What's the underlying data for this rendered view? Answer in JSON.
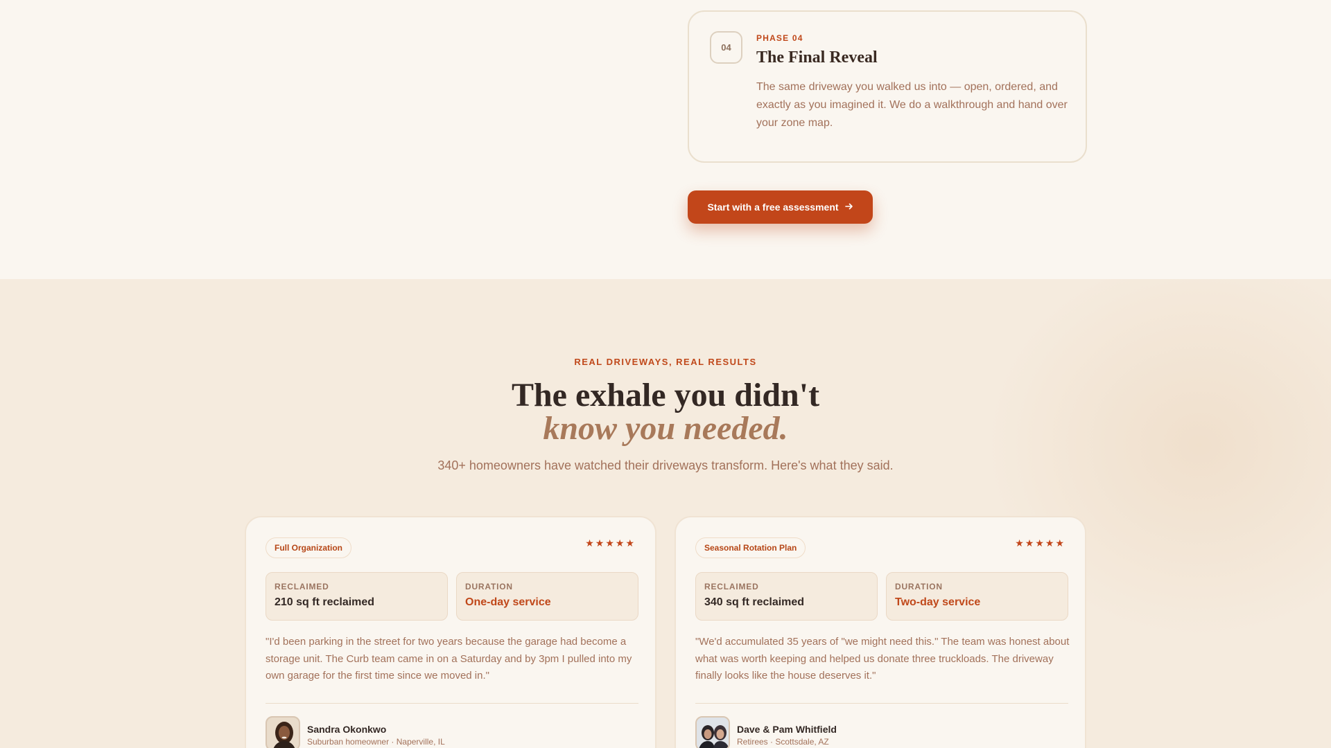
{
  "phase": {
    "number": "04",
    "label": "PHASE 04",
    "title": "The Final Reveal",
    "description": "The same driveway you walked us into — open, ordered, and exactly as you imagined it. We do a walkthrough and hand over your zone map."
  },
  "cta": {
    "label": "Start with a free assessment",
    "icon": "arrow-right-icon"
  },
  "testimonials": {
    "eyebrow": "REAL DRIVEWAYS, REAL RESULTS",
    "headline_line1": "The exhale you didn't",
    "headline_line2": "know you needed.",
    "subhead": "340+ homeowners have watched their driveways transform. Here's what they said.",
    "cards": [
      {
        "tag": "Full Organization",
        "stars": "★★★★★",
        "rating": 5,
        "stat1_label": "RECLAIMED",
        "stat1_value": "210 sq ft reclaimed",
        "stat2_label": "DURATION",
        "stat2_value": "One-day service",
        "quote": "\"I'd been parking in the street for two years because the garage had become a storage unit. The Curb team came in on a Saturday and by 3pm I pulled into my own garage for the first time since we moved in.\"",
        "author_name": "Sandra Okonkwo",
        "author_meta": "Suburban homeowner · Naperville, IL"
      },
      {
        "tag": "Seasonal Rotation Plan",
        "stars": "★★★★★",
        "rating": 5,
        "stat1_label": "RECLAIMED",
        "stat1_value": "340 sq ft reclaimed",
        "stat2_label": "DURATION",
        "stat2_value": "Two-day service",
        "quote": "\"We'd accumulated 35 years of \"we might need this.\" The team was honest about what was worth keeping and helped us donate three truckloads. The driveway finally looks like the house deserves it.\"",
        "author_name": "Dave & Pam Whitfield",
        "author_meta": "Retirees · Scottsdale, AZ"
      }
    ]
  },
  "colors": {
    "accent": "#c2461a",
    "page_bg": "#faf6f0",
    "section_bg": "#f5ebde",
    "muted_text": "#a2715a",
    "heading_text": "#332824",
    "italic_accent": "#a8795a"
  }
}
